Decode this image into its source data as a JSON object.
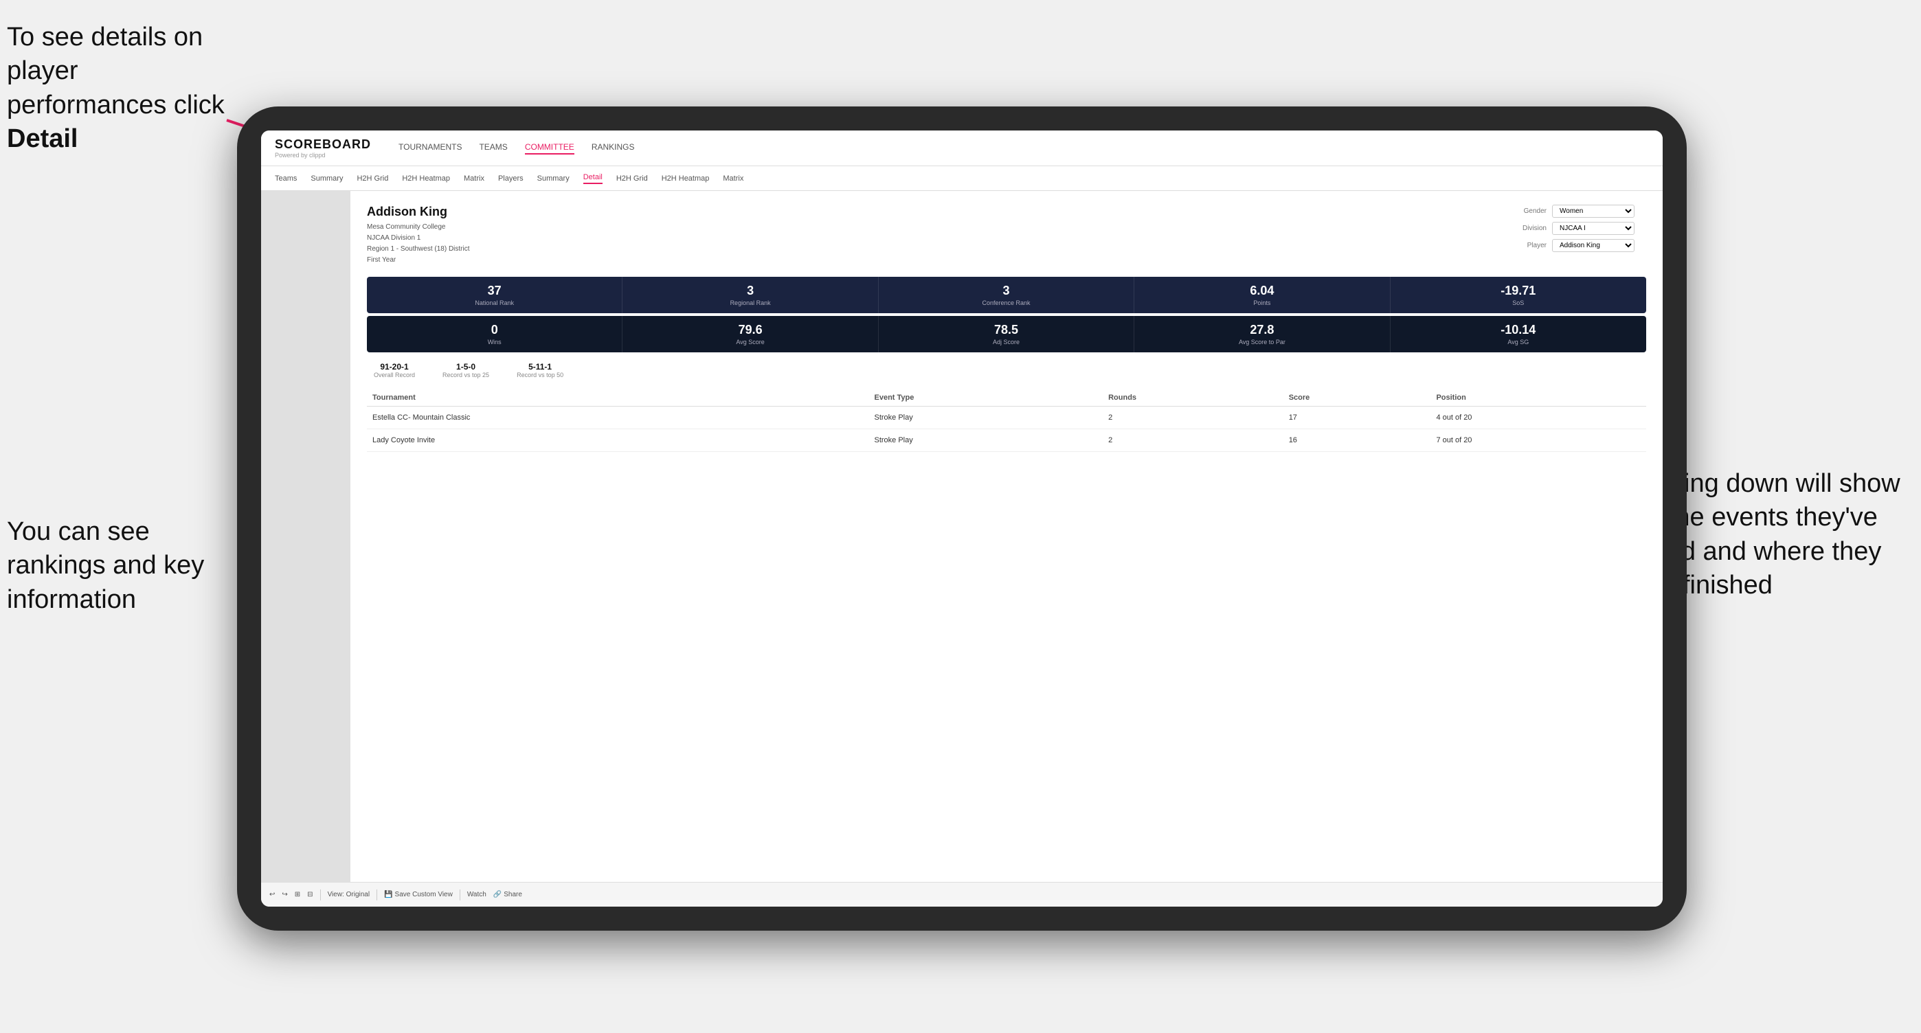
{
  "annotations": {
    "top_left": "To see details on player performances click Detail",
    "bottom_left": "You can see rankings and key information",
    "right": "Scrolling down will show you the events they've played and where they have finished"
  },
  "nav": {
    "logo": "SCOREBOARD",
    "logo_sub": "Powered by clippd",
    "items": [
      "TOURNAMENTS",
      "TEAMS",
      "COMMITTEE",
      "RANKINGS"
    ]
  },
  "sub_nav": {
    "items": [
      "Teams",
      "Summary",
      "H2H Grid",
      "H2H Heatmap",
      "Matrix",
      "Players",
      "Summary",
      "Detail",
      "H2H Grid",
      "H2H Heatmap",
      "Matrix"
    ],
    "active": "Detail"
  },
  "player": {
    "name": "Addison King",
    "school": "Mesa Community College",
    "division": "NJCAA Division 1",
    "region": "Region 1 - Southwest (18) District",
    "year": "First Year",
    "gender_label": "Gender",
    "gender_value": "Women",
    "division_label": "Division",
    "division_value": "NJCAA I",
    "player_label": "Player",
    "player_value": "Addison King"
  },
  "stats_row1": [
    {
      "value": "37",
      "label": "National Rank"
    },
    {
      "value": "3",
      "label": "Regional Rank"
    },
    {
      "value": "3",
      "label": "Conference Rank"
    },
    {
      "value": "6.04",
      "label": "Points"
    },
    {
      "value": "-19.71",
      "label": "SoS"
    }
  ],
  "stats_row2": [
    {
      "value": "0",
      "label": "Wins"
    },
    {
      "value": "79.6",
      "label": "Avg Score"
    },
    {
      "value": "78.5",
      "label": "Adj Score"
    },
    {
      "value": "27.8",
      "label": "Avg Score to Par"
    },
    {
      "value": "-10.14",
      "label": "Avg SG"
    }
  ],
  "records": [
    {
      "value": "91-20-1",
      "label": "Overall Record"
    },
    {
      "value": "1-5-0",
      "label": "Record vs top 25"
    },
    {
      "value": "5-11-1",
      "label": "Record vs top 50"
    }
  ],
  "table": {
    "headers": [
      "Tournament",
      "Event Type",
      "Rounds",
      "Score",
      "Position"
    ],
    "rows": [
      {
        "tournament": "Estella CC- Mountain Classic",
        "event_type": "Stroke Play",
        "rounds": "2",
        "score": "17",
        "position": "4 out of 20"
      },
      {
        "tournament": "Lady Coyote Invite",
        "event_type": "Stroke Play",
        "rounds": "2",
        "score": "16",
        "position": "7 out of 20"
      }
    ]
  },
  "toolbar": {
    "buttons": [
      "View: Original",
      "Save Custom View",
      "Watch",
      "Share"
    ]
  }
}
